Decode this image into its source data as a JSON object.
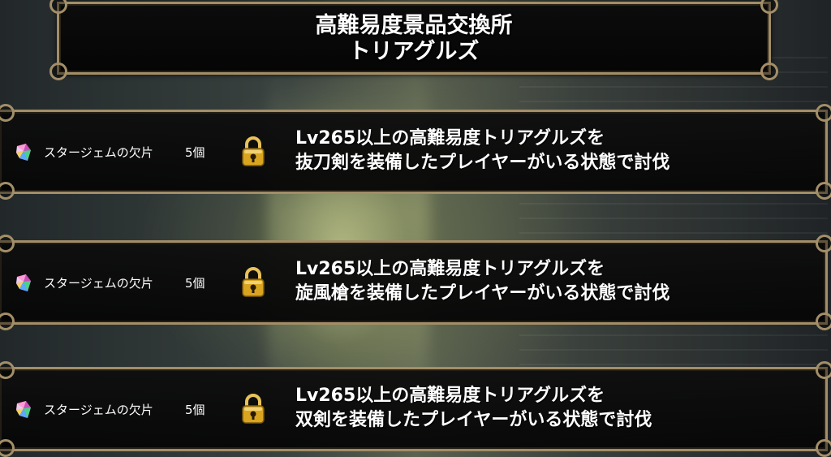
{
  "header": {
    "title_line1": "高難易度景品交換所",
    "title_line2": "トリアグルズ"
  },
  "rewards": [
    {
      "item_name": "スタージェムの欠片",
      "count": "5個",
      "condition_line1": "Lv265以上の高難易度トリアグルズを",
      "condition_line2": "抜刀剣を装備したプレイヤーがいる状態で討伐",
      "locked": true
    },
    {
      "item_name": "スタージェムの欠片",
      "count": "5個",
      "condition_line1": "Lv265以上の高難易度トリアグルズを",
      "condition_line2": "旋風槍を装備したプレイヤーがいる状態で討伐",
      "locked": true
    },
    {
      "item_name": "スタージェムの欠片",
      "count": "5個",
      "condition_line1": "Lv265以上の高難易度トリアグルズを",
      "condition_line2": "双剣を装備したプレイヤーがいる状態で討伐",
      "locked": true
    }
  ],
  "icons": {
    "reward": "star-gem-fragment-icon",
    "lock": "padlock-icon"
  },
  "colors": {
    "frame_gold": "#a38e68",
    "panel_black": "#0a0a0a",
    "lock_gold": "#d9a520"
  }
}
